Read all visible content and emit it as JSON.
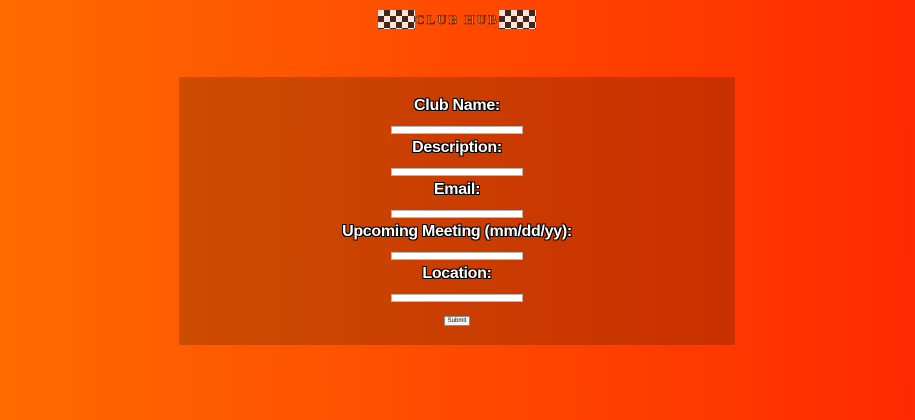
{
  "logo": {
    "text": "CLUB HUB"
  },
  "form": {
    "fields": [
      {
        "label": "Club Name:",
        "value": ""
      },
      {
        "label": "Description:",
        "value": ""
      },
      {
        "label": "Email:",
        "value": ""
      },
      {
        "label": "Upcoming Meeting (mm/dd/yy):",
        "value": ""
      },
      {
        "label": "Location:",
        "value": ""
      }
    ],
    "submit_label": "Submit"
  },
  "colors": {
    "background_start": "#ff6a00",
    "background_end": "#ff2a00",
    "panel": "#c93d00"
  }
}
